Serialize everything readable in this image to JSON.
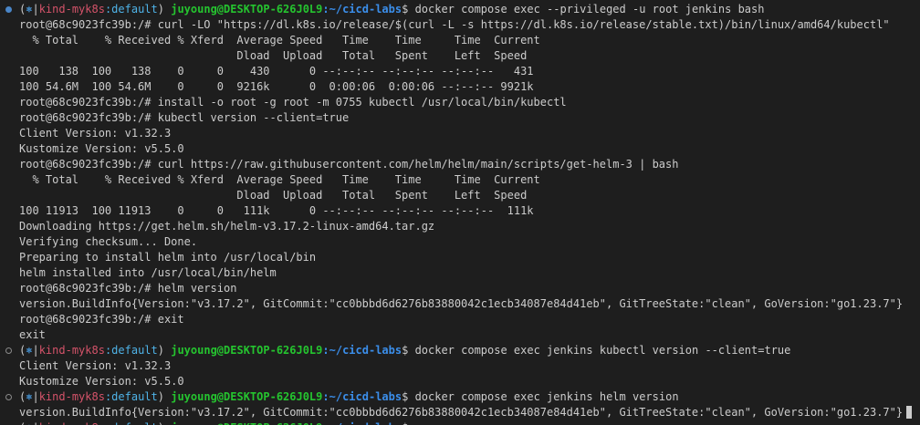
{
  "colors": {
    "background": "#1e1e1e",
    "text": "#cccccc",
    "context": "#d5536a",
    "namespace_sep": "#4fb3e8",
    "user": "#25c42f",
    "path": "#3b8eea",
    "marker": "#4a86c8"
  },
  "icons": {
    "helm_symbol": "⎈",
    "marker_filled": "prompt-marker-filled-icon",
    "marker_hollow": "prompt-marker-hollow-icon"
  },
  "prompt": {
    "open_paren": "(",
    "close_paren": ")",
    "helm_symbol": "⎈",
    "pipe": "|",
    "context": "kind-myk8s",
    "colon_ns": ":default",
    "user_host": "juyoung@DESKTOP-626J0L9",
    "path_label": ":~/cicd-labs",
    "dollar": "$"
  },
  "lines": [
    {
      "kind": "host",
      "marker": "filled",
      "cmd": "docker compose exec --privileged -u root jenkins bash"
    },
    {
      "kind": "out",
      "text": "root@68c9023fc39b:/# curl -LO \"https://dl.k8s.io/release/$(curl -L -s https://dl.k8s.io/release/stable.txt)/bin/linux/amd64/kubectl\""
    },
    {
      "kind": "out",
      "text": "  % Total    % Received % Xferd  Average Speed   Time    Time     Time  Current"
    },
    {
      "kind": "out",
      "text": "                                 Dload  Upload   Total   Spent    Left  Speed"
    },
    {
      "kind": "out",
      "text": "100   138  100   138    0     0    430      0 --:--:-- --:--:-- --:--:--   431"
    },
    {
      "kind": "out",
      "text": "100 54.6M  100 54.6M    0     0  9216k      0  0:00:06  0:00:06 --:--:-- 9921k"
    },
    {
      "kind": "out",
      "text": "root@68c9023fc39b:/# install -o root -g root -m 0755 kubectl /usr/local/bin/kubectl"
    },
    {
      "kind": "out",
      "text": "root@68c9023fc39b:/# kubectl version --client=true"
    },
    {
      "kind": "out",
      "text": "Client Version: v1.32.3"
    },
    {
      "kind": "out",
      "text": "Kustomize Version: v5.5.0"
    },
    {
      "kind": "out",
      "text": "root@68c9023fc39b:/# curl https://raw.githubusercontent.com/helm/helm/main/scripts/get-helm-3 | bash"
    },
    {
      "kind": "out",
      "text": "  % Total    % Received % Xferd  Average Speed   Time    Time     Time  Current"
    },
    {
      "kind": "out",
      "text": "                                 Dload  Upload   Total   Spent    Left  Speed"
    },
    {
      "kind": "out",
      "text": "100 11913  100 11913    0     0   111k      0 --:--:-- --:--:-- --:--:--  111k"
    },
    {
      "kind": "out",
      "text": "Downloading https://get.helm.sh/helm-v3.17.2-linux-amd64.tar.gz"
    },
    {
      "kind": "out",
      "text": "Verifying checksum... Done."
    },
    {
      "kind": "out",
      "text": "Preparing to install helm into /usr/local/bin"
    },
    {
      "kind": "out",
      "text": "helm installed into /usr/local/bin/helm"
    },
    {
      "kind": "out",
      "text": "root@68c9023fc39b:/# helm version"
    },
    {
      "kind": "out",
      "text": "version.BuildInfo{Version:\"v3.17.2\", GitCommit:\"cc0bbbd6d6276b83880042c1ecb34087e84d41eb\", GitTreeState:\"clean\", GoVersion:\"go1.23.7\"}"
    },
    {
      "kind": "out",
      "text": "root@68c9023fc39b:/# exit"
    },
    {
      "kind": "out",
      "text": "exit"
    },
    {
      "kind": "host",
      "marker": "hollow",
      "cmd": "docker compose exec jenkins kubectl version --client=true"
    },
    {
      "kind": "out",
      "text": "Client Version: v1.32.3"
    },
    {
      "kind": "out",
      "text": "Kustomize Version: v5.5.0"
    },
    {
      "kind": "host",
      "marker": "hollow",
      "cmd": "docker compose exec jenkins helm version"
    },
    {
      "kind": "out",
      "text": "version.BuildInfo{Version:\"v3.17.2\", GitCommit:\"cc0bbbd6d6276b83880042c1ecb34087e84d41eb\", GitTreeState:\"clean\", GoVersion:\"go1.23.7\"}",
      "cursor": true
    },
    {
      "kind": "host",
      "marker": "hollow",
      "cmd": ""
    }
  ]
}
